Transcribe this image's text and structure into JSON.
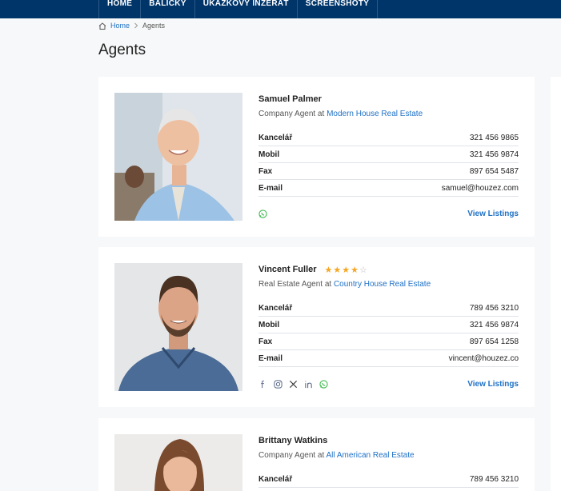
{
  "nav": {
    "items": [
      "HOME",
      "BALÍČKY",
      "UKÁZKOVÝ INZERÁT",
      "SCREENSHOTY"
    ]
  },
  "breadcrumb": {
    "home": "Home",
    "current": "Agents"
  },
  "page": {
    "title": "Agents"
  },
  "labels": {
    "office": "Kancelář",
    "mobile": "Mobil",
    "fax": "Fax",
    "email": "E-mail",
    "view_listings": "View Listings"
  },
  "agents": [
    {
      "name": "Samuel Palmer",
      "role_prefix": "Company Agent at",
      "company": "Modern House Real Estate",
      "office": "321 456 9865",
      "mobile": "321 456 9874",
      "fax": "897 654 5487",
      "email": "samuel@houzez.com",
      "socials": [
        "whatsapp-icon"
      ]
    },
    {
      "name": "Vincent Fuller",
      "rating": 4,
      "role_prefix": "Real Estate Agent at",
      "company": "Country House Real Estate",
      "office": "789 456 3210",
      "mobile": "321 456 9874",
      "fax": "897 654 1258",
      "email": "vincent@houzez.co",
      "socials": [
        "facebook-icon",
        "instagram-icon",
        "x-icon",
        "linkedin-icon",
        "whatsapp-icon"
      ]
    },
    {
      "name": "Brittany Watkins",
      "role_prefix": "Company Agent at",
      "company": "All American Real Estate",
      "office": "789 456 3210"
    }
  ],
  "colors": {
    "nav_bg": "#00356a",
    "link": "#1e70c6",
    "star": "#f5a623",
    "whatsapp": "#3fba50"
  }
}
